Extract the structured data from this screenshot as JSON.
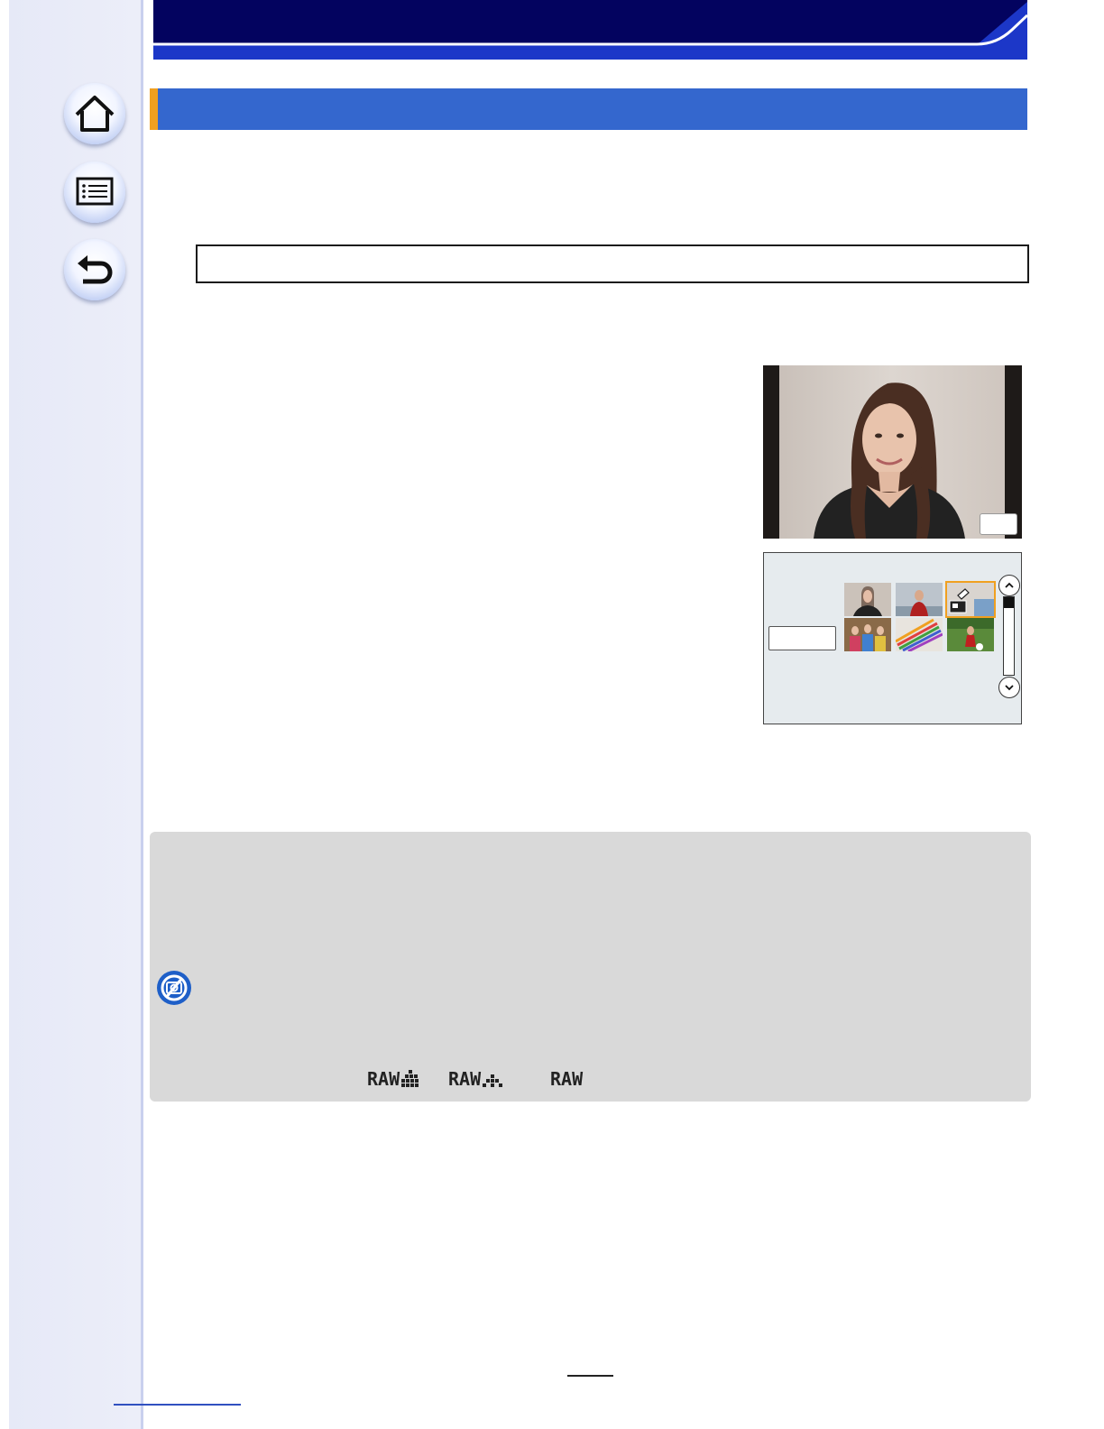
{
  "header": {
    "title": ""
  },
  "section": {
    "title": ""
  },
  "navigation": {
    "buttons": [
      {
        "name": "home",
        "icon": "home-icon"
      },
      {
        "name": "menu",
        "icon": "list-icon"
      },
      {
        "name": "back",
        "icon": "back-arrow-icon"
      }
    ]
  },
  "note_box": {
    "text": ""
  },
  "raw_icons": [
    {
      "label": "RAW",
      "icon": "fine-quality-icon"
    },
    {
      "label": "RAW",
      "icon": "standard-quality-icon"
    },
    {
      "label": "RAW",
      "icon": ""
    }
  ],
  "colors": {
    "header_navy": "#03035f",
    "header_blue": "#1c37c8",
    "section_blue": "#3467ce",
    "accent_orange": "#f0a020",
    "note_gray": "#d9d9d9"
  },
  "page": {
    "number": ""
  }
}
